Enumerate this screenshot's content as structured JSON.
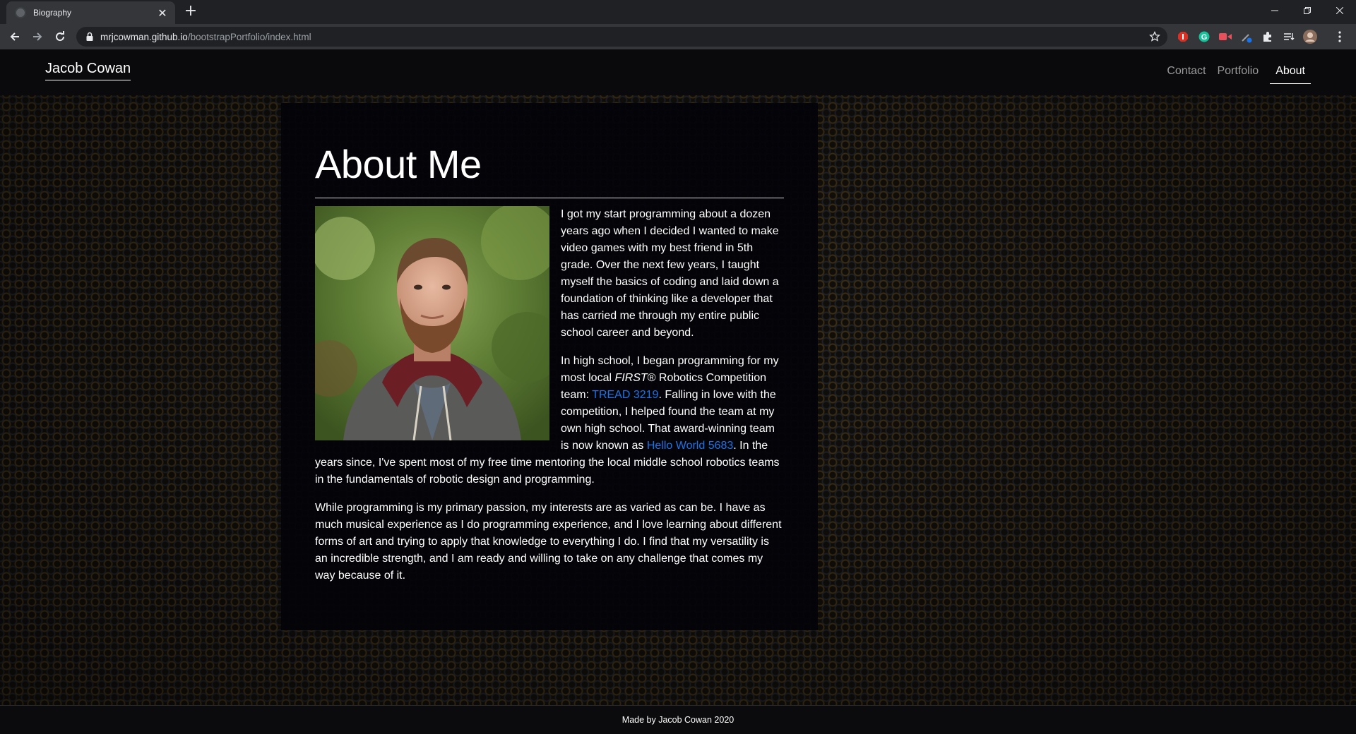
{
  "browser": {
    "tab_title": "Biography",
    "url_host": "mrjcowman.github.io",
    "url_path": "/bootstrapPortfolio/index.html"
  },
  "navbar": {
    "brand": "Jacob Cowan",
    "links": [
      {
        "label": "Contact",
        "active": false
      },
      {
        "label": "Portfolio",
        "active": false
      },
      {
        "label": "About",
        "active": true
      }
    ]
  },
  "about": {
    "title": "About Me",
    "para1": "I got my start programming about a dozen years ago when I decided I wanted to make video games with my best friend in 5th grade. Over the next few years, I taught myself the basics of coding and laid down a foundation of thinking like a developer that has carried me through my entire public school career and beyond.",
    "para2_part1": "In high school, I began programming for my most local ",
    "para2_em": "FIRST",
    "para2_part2": "® Robotics Competition team: ",
    "para2_link1": "TREAD 3219",
    "para2_part3": ". Falling in love with the competition, I helped found the team at my own high school. That award-winning team is now known as ",
    "para2_link2": "Hello World 5683",
    "para2_part4": ". In the years since, I've spent most of my free time mentoring the local middle school robotics teams in the fundamentals of robotic design and programming.",
    "para3": "While programming is my primary passion, my interests are as varied as can be. I have as much musical experience as I do programming experience, and I love learning about different forms of art and trying to apply that knowledge to everything I do. I find that my versatility is an incredible strength, and I am ready and willing to take on any challenge that comes my way because of it."
  },
  "footer": {
    "text": "Made by Jacob Cowan 2020"
  },
  "colors": {
    "link": "#1a73e8",
    "card_bg": "#030308",
    "navbar_bg": "#0a0a0c"
  }
}
